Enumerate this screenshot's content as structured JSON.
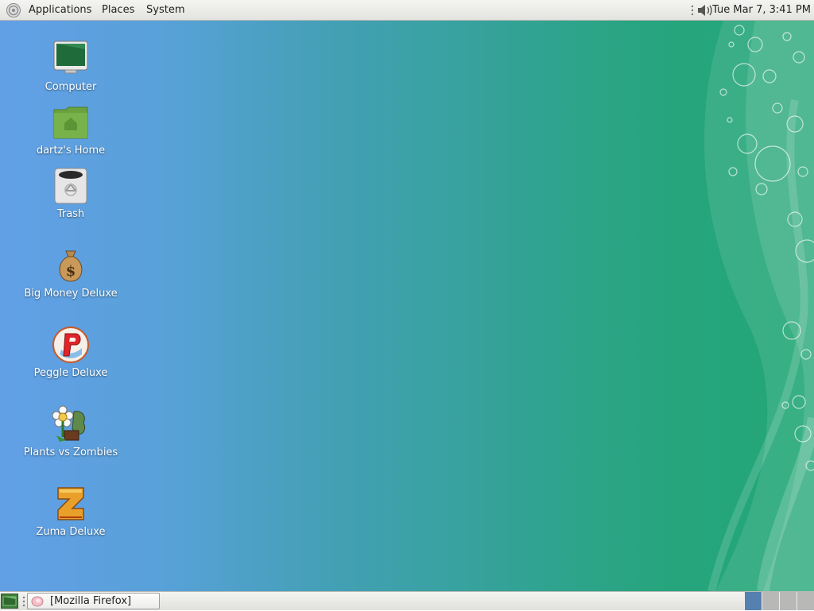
{
  "top_panel": {
    "menus": {
      "applications": "Applications",
      "places": "Places",
      "system": "System"
    },
    "clock": "Tue Mar  7,  3:41 PM",
    "icons": [
      "foot-logo-icon",
      "volume-icon"
    ]
  },
  "desktop": {
    "icons": [
      {
        "label": "Computer",
        "icon": "computer-icon"
      },
      {
        "label": "dartz's Home",
        "icon": "home-folder-icon"
      },
      {
        "label": "Trash",
        "icon": "trash-icon"
      },
      {
        "label": "Big Money Deluxe",
        "icon": "money-bag-icon"
      },
      {
        "label": "Peggle Deluxe",
        "icon": "peggle-icon"
      },
      {
        "label": "Plants vs Zombies",
        "icon": "plants-vs-zombies-icon"
      },
      {
        "label": "Zuma Deluxe",
        "icon": "zuma-icon"
      }
    ]
  },
  "bottom_panel": {
    "taskbar": [
      {
        "label": "[Mozilla Firefox]",
        "icon": "firefox-icon"
      }
    ],
    "workspaces": 4,
    "active_workspace": 1
  },
  "colors": {
    "panel": "#e9e9e6",
    "desktop_left": "#62a0e6",
    "desktop_right": "#22a676",
    "active_workspace": "#5680b0"
  }
}
